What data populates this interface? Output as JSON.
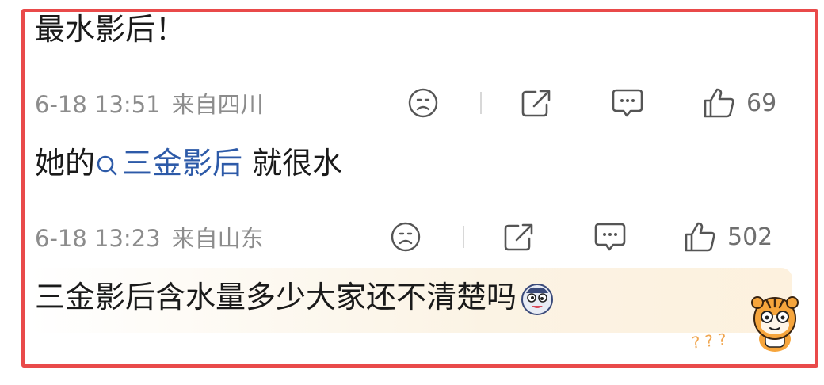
{
  "comments": [
    {
      "text": "最水影后！"
    },
    {
      "date": "6-18 13:51",
      "location": "来自四川",
      "likes": "69",
      "text_before": "她的",
      "hashtag": "三金影后",
      "text_after": " 就很水"
    },
    {
      "date": "6-18 13:23",
      "location": "来自山东",
      "likes": "502",
      "text": "三金影后含水量多少大家还不清楚吗"
    }
  ],
  "icons": {
    "dislike": "sad-face-icon",
    "share": "share-icon",
    "reply": "comment-bubble-icon",
    "like": "thumbs-up-icon",
    "search": "search-icon",
    "emoji": "dizzy-face-emoji",
    "mascot": "tiger-mascot-sticker"
  },
  "colors": {
    "highlight_frame": "#e94a4a",
    "hashtag": "#2d5aa8",
    "meta": "#8c8c8c",
    "question_marks": "#f0a650"
  },
  "sticker_text": "???"
}
